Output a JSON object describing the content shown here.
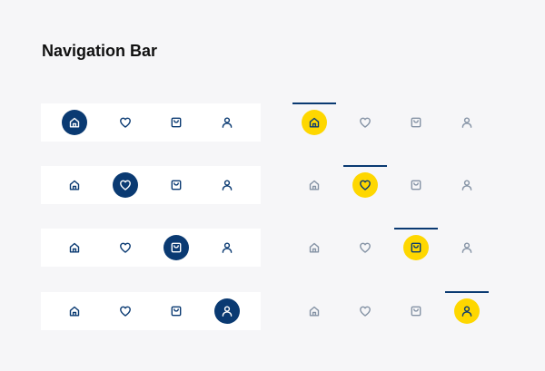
{
  "page": {
    "title": "Navigation Bar"
  },
  "colors": {
    "background": "#f6f6f8",
    "bar_background": "#ffffff",
    "primary_navy": "#0a3a72",
    "accent_yellow": "#fed700",
    "inactive_gray": "#8593a5"
  },
  "nav_items": [
    {
      "key": "home",
      "icon": "home-icon"
    },
    {
      "key": "favorites",
      "icon": "heart-icon"
    },
    {
      "key": "shop",
      "icon": "shopping-bag-icon"
    },
    {
      "key": "profile",
      "icon": "user-icon"
    }
  ],
  "variants": [
    {
      "style": "filled-circle",
      "rows": [
        {
          "active": "home"
        },
        {
          "active": "favorites"
        },
        {
          "active": "shop"
        },
        {
          "active": "profile"
        }
      ]
    },
    {
      "style": "yellow-circle-with-top-indicator",
      "rows": [
        {
          "active": "home"
        },
        {
          "active": "favorites"
        },
        {
          "active": "shop"
        },
        {
          "active": "profile"
        }
      ]
    }
  ]
}
